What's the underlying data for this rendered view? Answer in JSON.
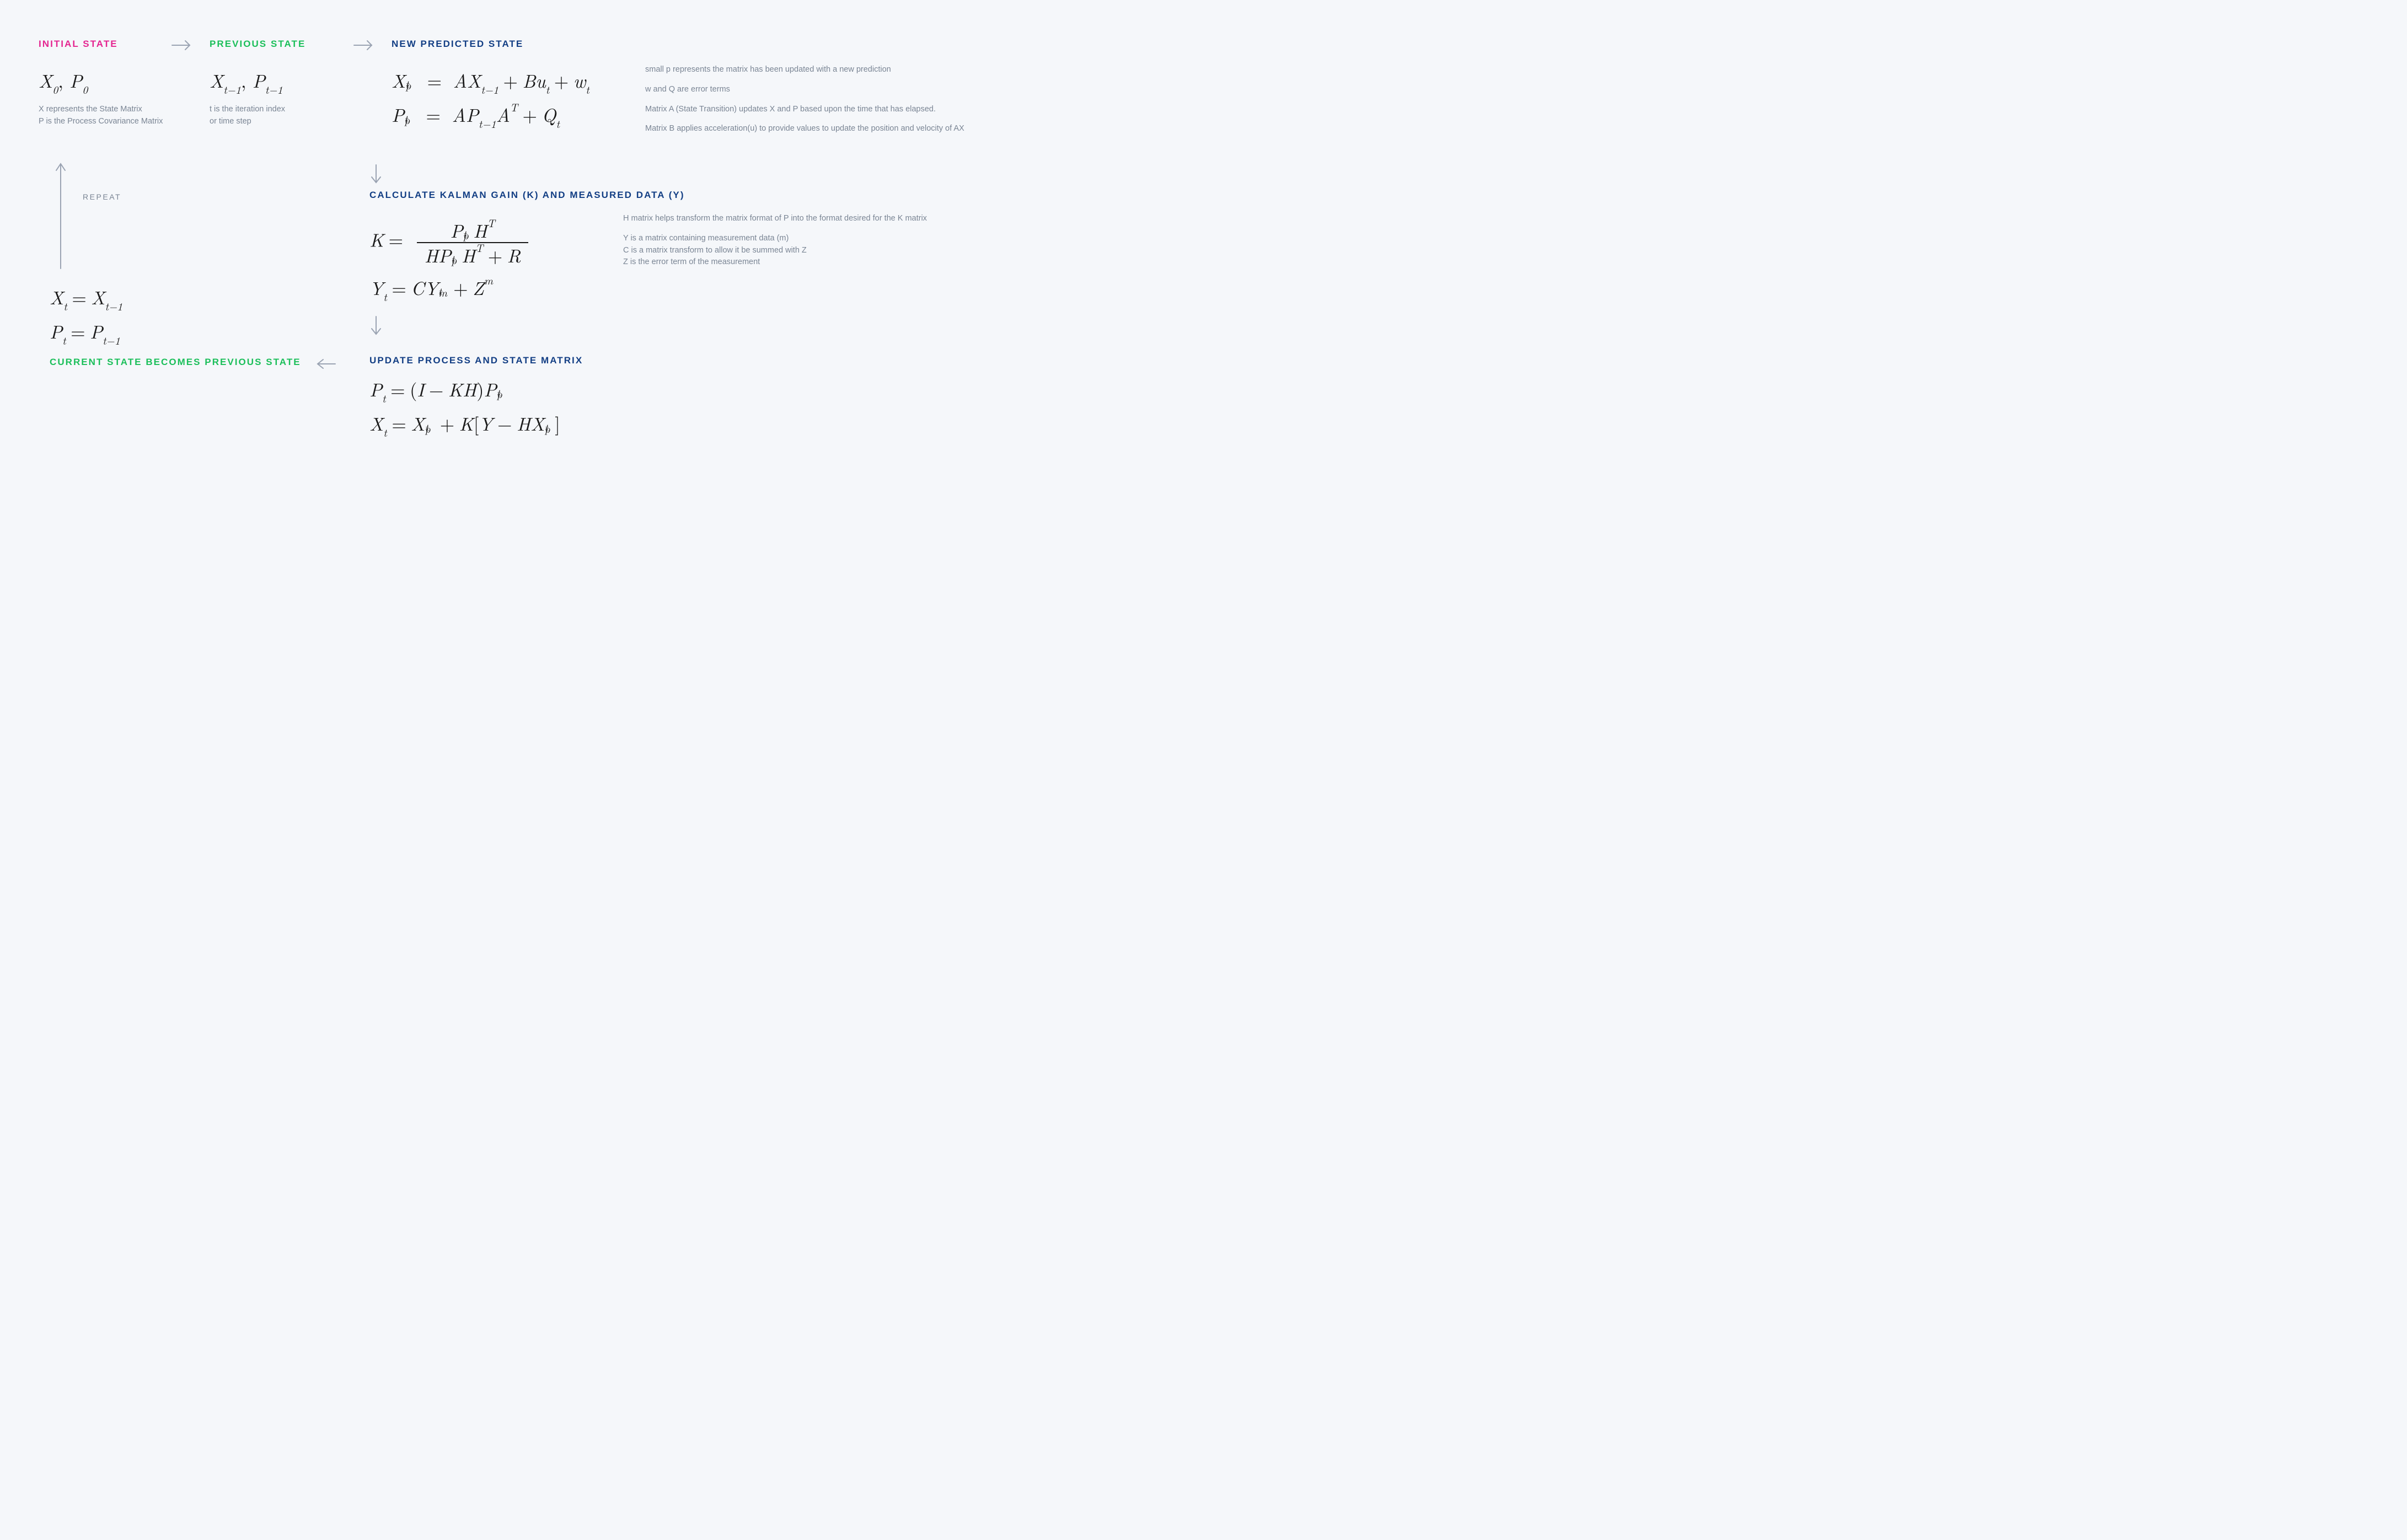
{
  "titles": {
    "initial": "INITIAL STATE",
    "previous": "PREVIOUS STATE",
    "predicted": "NEW PREDICTED STATE",
    "kalman": "CALCULATE KALMAN GAIN (K) AND MEASURED DATA (Y)",
    "update": "UPDATE PROCESS AND STATE MATRIX",
    "loopback": "CURRENT STATE BECOMES PREVIOUS STATE",
    "repeat": "REPEAT"
  },
  "notes": {
    "initial": "X represents the State Matrix\nP is the Process Covariance Matrix",
    "previous": "t is the iteration index\nor time step",
    "predicted_1": "small p represents the matrix has been updated with a new prediction",
    "predicted_2": "w and Q are error terms",
    "predicted_3": "Matrix A (State Transition) updates X and P based upon the time that has elapsed.",
    "predicted_4": "Matrix B applies acceleration(u) to provide values to update the position and velocity of AX",
    "kalman_1": "H matrix helps transform the matrix format of P into the format desired for the K matrix",
    "kalman_2": "Y is a matrix containing measurement data (m)\nC is a matrix transform to allow it be summed with Z\nZ is the error term of the measurement"
  },
  "equations": {
    "initial_X": "X",
    "initial_X_sub": "0",
    "initial_P": "P",
    "initial_P_sub": "0",
    "prev_X": "X",
    "prev_X_sub": "t−1",
    "prev_P": "P",
    "prev_P_sub": "t−1",
    "pred_X_lhs_base": "X",
    "pred_X_lhs_sup": "p",
    "pred_X_lhs_sub": "t",
    "pred_X_rhs": "AX_{t−1} + Bu_t + w_t",
    "pred_P_lhs_base": "P",
    "pred_P_lhs_sup": "p",
    "pred_P_lhs_sub": "t",
    "pred_P_rhs": "AP_{t−1}A^T + Q_t",
    "K_lhs": "K",
    "K_num": "P^{p}_{t} H^{T}",
    "K_den": "H P^{p}_{t} H^{T} + R",
    "Y_lhs_base": "Y",
    "Y_lhs_sub": "t",
    "Y_rhs": "C Y^{m}_{t} + Z^{m}",
    "upd_P_lhs_base": "P",
    "upd_P_lhs_sub": "t",
    "upd_P_rhs": "(I − KH) P^{p}_{t}",
    "upd_X_lhs_base": "X",
    "upd_X_lhs_sub": "t",
    "upd_X_rhs": "X^{p}_{t} + K[Y − H X^{p}_{t}]",
    "loop_X": "X_t = X_{t−1}",
    "loop_P": "P_t = P_{t−1}"
  }
}
